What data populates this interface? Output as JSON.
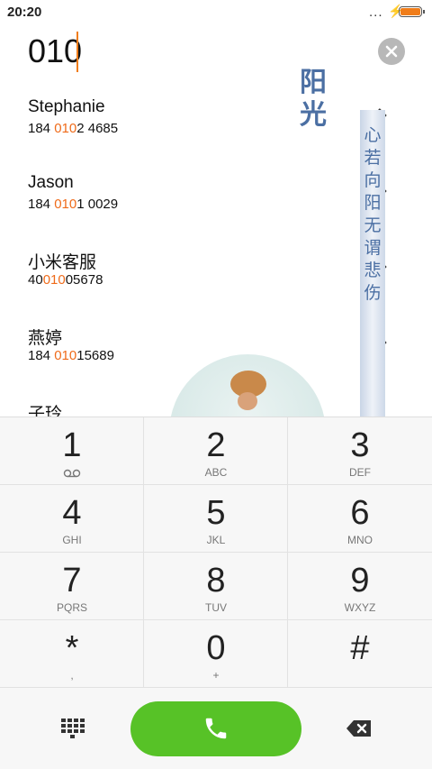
{
  "status": {
    "time": "20:20",
    "signal_dots": "...",
    "charging_icon": "bolt-icon",
    "battery_color": "#f07d1a"
  },
  "dialer": {
    "number": "010",
    "clear_icon": "clear-icon"
  },
  "contacts": [
    {
      "name": "Stephanie",
      "phone_pre": "184 ",
      "phone_hl": "010",
      "phone_post": "2 4685"
    },
    {
      "name": "Jason",
      "phone_pre": "184 ",
      "phone_hl": "010",
      "phone_post": "1 0029"
    },
    {
      "name": "小米客服",
      "phone_pre": "40",
      "phone_hl": "010",
      "phone_post": "05678"
    },
    {
      "name": "燕婷",
      "phone_pre": "184 ",
      "phone_hl": "010",
      "phone_post": "15689"
    },
    {
      "name": "子玲",
      "phone_pre": "",
      "phone_hl": "",
      "phone_post": ""
    }
  ],
  "decoration": {
    "title": "阳光",
    "verse": "心若向阳无谓悲伤"
  },
  "keypad": {
    "keys": [
      {
        "digit": "1",
        "letters": ""
      },
      {
        "digit": "2",
        "letters": "ABC"
      },
      {
        "digit": "3",
        "letters": "DEF"
      },
      {
        "digit": "4",
        "letters": "GHI"
      },
      {
        "digit": "5",
        "letters": "JKL"
      },
      {
        "digit": "6",
        "letters": "MNO"
      },
      {
        "digit": "7",
        "letters": "PQRS"
      },
      {
        "digit": "8",
        "letters": "TUV"
      },
      {
        "digit": "9",
        "letters": "WXYZ"
      },
      {
        "digit": "*",
        "letters": ","
      },
      {
        "digit": "0",
        "letters": "+"
      },
      {
        "digit": "#",
        "letters": ""
      }
    ]
  },
  "actions": {
    "call_color": "#57c227",
    "keypad_icon": "keypad-grid-icon",
    "call_icon": "phone-icon",
    "delete_icon": "backspace-icon"
  }
}
